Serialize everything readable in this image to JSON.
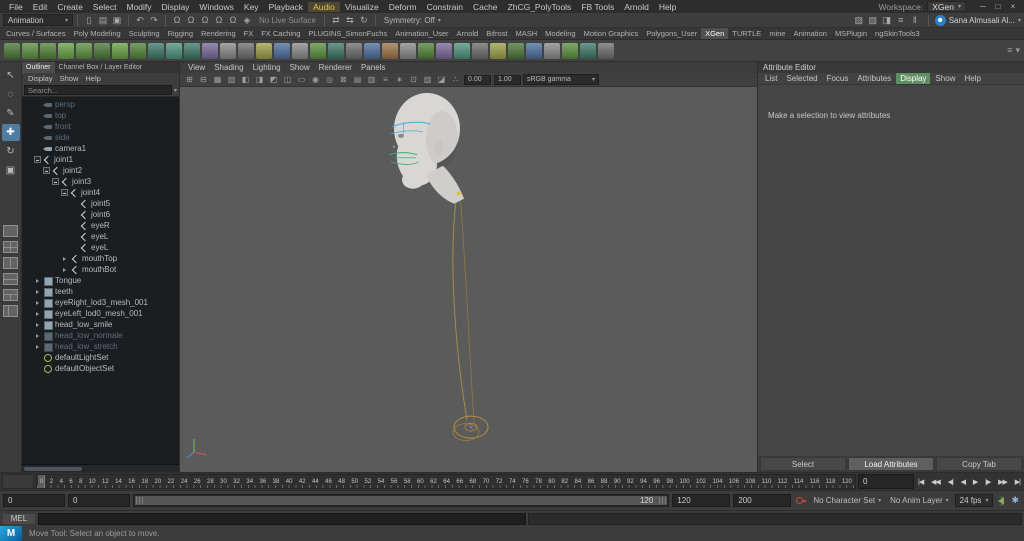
{
  "window": {
    "workspace_label": "Workspace:",
    "workspace_value": "XGen",
    "controls": [
      {
        "name": "minimize-button",
        "glyph": "─"
      },
      {
        "name": "restore-button",
        "glyph": "□"
      },
      {
        "name": "close-button",
        "glyph": "×"
      }
    ]
  },
  "menubar": {
    "items": [
      "File",
      "Edit",
      "Create",
      "Select",
      "Modify",
      "Display",
      "Windows",
      "Key",
      "Playback",
      "Audio",
      "Visualize",
      "Deform",
      "Constrain",
      "Cache",
      "ZhCG_PolyTools",
      "FB Tools",
      "Arnold",
      "Help"
    ],
    "highlighted": "Audio"
  },
  "toolbar": {
    "menu_set": "Animation",
    "file_icons": [
      {
        "name": "new-scene-icon",
        "glyph": "▯"
      },
      {
        "name": "open-scene-icon",
        "glyph": "▤"
      },
      {
        "name": "save-scene-icon",
        "glyph": "▣"
      }
    ],
    "history_icons": [
      {
        "name": "undo-icon",
        "glyph": "↶"
      },
      {
        "name": "redo-icon",
        "glyph": "↷"
      }
    ],
    "snap_icons": [
      {
        "name": "snap-to-grids-icon",
        "glyph": "Ω"
      },
      {
        "name": "snap-to-curves-icon",
        "glyph": "Ω"
      },
      {
        "name": "snap-to-points-icon",
        "glyph": "Ω"
      },
      {
        "name": "snap-to-projected-center-icon",
        "glyph": "Ω"
      },
      {
        "name": "snap-to-view-planes-icon",
        "glyph": "Ω"
      },
      {
        "name": "make-live-icon",
        "glyph": "◈"
      }
    ],
    "no_live_surface": "No Live Surface",
    "connection_icons": [
      {
        "name": "input-connections-icon",
        "glyph": "⇄"
      },
      {
        "name": "output-connections-icon",
        "glyph": "⇆"
      },
      {
        "name": "construction-history-icon",
        "glyph": "↻"
      }
    ],
    "symmetry": "Symmetry: Off",
    "render_icons": [
      {
        "name": "open-render-view-icon",
        "glyph": "▧"
      },
      {
        "name": "render-current-frame-icon",
        "glyph": "▨"
      },
      {
        "name": "ipr-render-icon",
        "glyph": "◨"
      },
      {
        "name": "render-settings-icon",
        "glyph": "≡"
      },
      {
        "name": "pause-viewport-icon",
        "glyph": "‖"
      }
    ],
    "user_name": "Sana Almusali Al..."
  },
  "shelf": {
    "tabs": [
      "Curves / Surfaces",
      "Poly Modeling",
      "Sculpting",
      "Rigging",
      "Rendering",
      "FX",
      "FX Caching",
      "PLUGINS_SimonFuchs",
      "Animation_User",
      "Arnold",
      "Bifrost",
      "MASH",
      "Modeling",
      "Motion Graphics",
      "Polygons_User",
      "XGen",
      "TURTLE",
      "mine",
      "Animation",
      "MSPlugin",
      "ngSkinTools3"
    ],
    "active_tab": "XGen",
    "icons": [
      {
        "color": "#4c7a36"
      },
      {
        "color": "#5d9140"
      },
      {
        "color": "#548539"
      },
      {
        "color": "#69a348"
      },
      {
        "color": "#5d9140"
      },
      {
        "color": "#4c7a36"
      },
      {
        "color": "#69a348"
      },
      {
        "color": "#548539"
      },
      {
        "color": "#3f7a6a"
      },
      {
        "color": "#4f9480"
      },
      {
        "color": "#3f7a6a"
      },
      {
        "color": "#7a6a9a"
      },
      {
        "color": "#8b8b8b"
      },
      {
        "color": "#6f6f6f"
      },
      {
        "color": "#a0a04a"
      },
      {
        "color": "#4f6f9f"
      },
      {
        "color": "#8b8b8b"
      },
      {
        "color": "#5d9140"
      },
      {
        "color": "#3f7a6a"
      },
      {
        "color": "#6f6f6f"
      },
      {
        "color": "#4f6f9f"
      },
      {
        "color": "#a0744a"
      },
      {
        "color": "#8b8b8b"
      },
      {
        "color": "#548539"
      },
      {
        "color": "#7a6a9a"
      },
      {
        "color": "#4f9480"
      },
      {
        "color": "#6f6f6f"
      },
      {
        "color": "#a0a04a"
      },
      {
        "color": "#4c7a36"
      },
      {
        "color": "#4f6f9f"
      },
      {
        "color": "#8b8b8b"
      },
      {
        "color": "#5d9140"
      },
      {
        "color": "#3f7a6a"
      },
      {
        "color": "#6f6f6f"
      }
    ]
  },
  "toolbox": {
    "tools": [
      {
        "name": "select-tool",
        "glyph": "↖"
      },
      {
        "name": "lasso-select-tool",
        "glyph": "◌"
      },
      {
        "name": "paint-select-tool",
        "glyph": "✎"
      },
      {
        "name": "move-tool",
        "glyph": "✚",
        "active": true
      },
      {
        "name": "rotate-tool",
        "glyph": "↻"
      },
      {
        "name": "scale-tool",
        "glyph": "▣"
      }
    ],
    "layouts": [
      {
        "name": "layout-single-pane-button",
        "variant": "single"
      },
      {
        "name": "layout-four-pane-button",
        "variant": "quad"
      },
      {
        "name": "layout-two-pane-side-button",
        "variant": "vsplit"
      },
      {
        "name": "layout-two-pane-stacked-button",
        "variant": "hsplit"
      },
      {
        "name": "layout-three-pane-button",
        "variant": "three"
      },
      {
        "name": "layout-outliner-persp-button",
        "variant": "left"
      }
    ]
  },
  "outliner": {
    "tabs": [
      "Outliner",
      "Channel Box / Layer Editor"
    ],
    "active_tab": "Outliner",
    "menus": [
      "Display",
      "Show",
      "Help"
    ],
    "search_placeholder": "Search...",
    "items": [
      {
        "label": "persp",
        "icon": "camera",
        "depth": 1,
        "dim": true
      },
      {
        "label": "top",
        "icon": "camera",
        "depth": 1,
        "dim": true
      },
      {
        "label": "front",
        "icon": "camera",
        "depth": 1,
        "dim": true
      },
      {
        "label": "side",
        "icon": "camera",
        "depth": 1,
        "dim": true
      },
      {
        "label": "camera1",
        "icon": "camera",
        "depth": 1
      },
      {
        "label": "joint1",
        "icon": "joint",
        "depth": 1,
        "exp": "-"
      },
      {
        "label": "joint2",
        "icon": "joint",
        "depth": 2,
        "exp": "-"
      },
      {
        "label": "joint3",
        "icon": "joint",
        "depth": 3,
        "exp": "-"
      },
      {
        "label": "joint4",
        "icon": "joint",
        "depth": 4,
        "exp": "-"
      },
      {
        "label": "joint5",
        "icon": "joint",
        "depth": 5
      },
      {
        "label": "joint6",
        "icon": "joint",
        "depth": 5
      },
      {
        "label": "eyeR",
        "icon": "joint",
        "depth": 5
      },
      {
        "label": "eyeL",
        "icon": "joint",
        "depth": 5
      },
      {
        "label": "eyeL",
        "icon": "joint",
        "depth": 5
      },
      {
        "label": "mouthTop",
        "icon": "joint",
        "depth": 4,
        "exp": ">"
      },
      {
        "label": "mouthBot",
        "icon": "joint",
        "depth": 4,
        "exp": ">"
      },
      {
        "label": "Tongue",
        "icon": "mesh",
        "depth": 1,
        "exp": ">"
      },
      {
        "label": "teeth",
        "icon": "mesh",
        "depth": 1,
        "exp": ">"
      },
      {
        "label": "eyeRight_lod3_mesh_001",
        "icon": "mesh",
        "depth": 1,
        "exp": ">"
      },
      {
        "label": "eyeLeft_lod0_mesh_001",
        "icon": "mesh",
        "depth": 1,
        "exp": ">"
      },
      {
        "label": "head_low_smile",
        "icon": "mesh",
        "depth": 1,
        "exp": ">"
      },
      {
        "label": "head_low_normale",
        "icon": "mesh",
        "depth": 1,
        "exp": ">",
        "dim": true
      },
      {
        "label": "head_low_stretch",
        "icon": "mesh",
        "depth": 1,
        "exp": ">",
        "dim": true
      },
      {
        "label": "defaultLightSet",
        "icon": "set",
        "depth": 1
      },
      {
        "label": "defaultObjectSet",
        "icon": "set",
        "depth": 1
      }
    ]
  },
  "viewport": {
    "menus": [
      "View",
      "Shading",
      "Lighting",
      "Show",
      "Renderer",
      "Panels"
    ],
    "icons": [
      {
        "glyph": "⊞"
      },
      {
        "glyph": "⊟"
      },
      {
        "glyph": "▦"
      },
      {
        "glyph": "▧"
      },
      {
        "glyph": "◧"
      },
      {
        "glyph": "◨"
      },
      {
        "glyph": "◩"
      },
      {
        "glyph": "◫"
      },
      {
        "glyph": "▭"
      },
      {
        "glyph": "◉"
      },
      {
        "glyph": "◎"
      },
      {
        "glyph": "⊠"
      },
      {
        "glyph": "▤"
      },
      {
        "glyph": "▥"
      },
      {
        "glyph": "≡"
      },
      {
        "glyph": "∗"
      },
      {
        "glyph": "⊡"
      },
      {
        "glyph": "▨"
      },
      {
        "glyph": "◪"
      },
      {
        "glyph": "∴"
      }
    ],
    "exposure": "0.00",
    "gamma": "1.00",
    "view_transform": "sRGB gamma",
    "scene_colors": {
      "head": "#d8d7d3",
      "eye_wires": "#4aa8e0",
      "mouth_wires": "#38b06e",
      "rig_curve": "#a68b4a",
      "control_circle": "#b5913f"
    }
  },
  "attribute_editor": {
    "title": "Attribute Editor",
    "menus": [
      "List",
      "Selected",
      "Focus",
      "Attributes",
      "Display",
      "Show",
      "Help"
    ],
    "highlighted_menu": "Display",
    "message": "Make a selection to view attributes",
    "buttons": [
      "Select",
      "Load Attributes",
      "Copy Tab"
    ],
    "active_button": "Load Attributes"
  },
  "timeline": {
    "ticks": [
      0,
      2,
      4,
      6,
      8,
      10,
      12,
      14,
      16,
      18,
      20,
      22,
      24,
      26,
      28,
      30,
      32,
      34,
      36,
      38,
      40,
      42,
      44,
      46,
      48,
      50,
      52,
      54,
      56,
      58,
      60,
      62,
      64,
      66,
      68,
      70,
      72,
      74,
      76,
      78,
      80,
      82,
      84,
      86,
      88,
      90,
      92,
      94,
      96,
      98,
      100,
      102,
      104,
      106,
      108,
      110,
      112,
      114,
      116,
      118,
      120
    ],
    "current_frame": "0",
    "playback_buttons": [
      {
        "name": "go-to-playback-start-button",
        "glyph": "|◀"
      },
      {
        "name": "step-back-one-key-button",
        "glyph": "◀◀"
      },
      {
        "name": "step-back-one-frame-button",
        "glyph": "◀|"
      },
      {
        "name": "play-backwards-button",
        "glyph": "◀"
      },
      {
        "name": "play-forwards-button",
        "glyph": "▶"
      },
      {
        "name": "step-forward-one-frame-button",
        "glyph": "|▶"
      },
      {
        "name": "step-forward-one-key-button",
        "glyph": "▶▶"
      },
      {
        "name": "go-to-playback-end-button",
        "glyph": "▶|"
      }
    ]
  },
  "range": {
    "animation_start": "0",
    "playback_start": "0",
    "range_bar_label": "120",
    "playback_end": "120",
    "animation_end": "200",
    "character_set": "No Character Set",
    "anim_layer": "No Anim Layer",
    "fps": "24 fps"
  },
  "command_line": {
    "label": "MEL"
  },
  "help_line": {
    "text": "Move Tool: Select an object to move."
  }
}
